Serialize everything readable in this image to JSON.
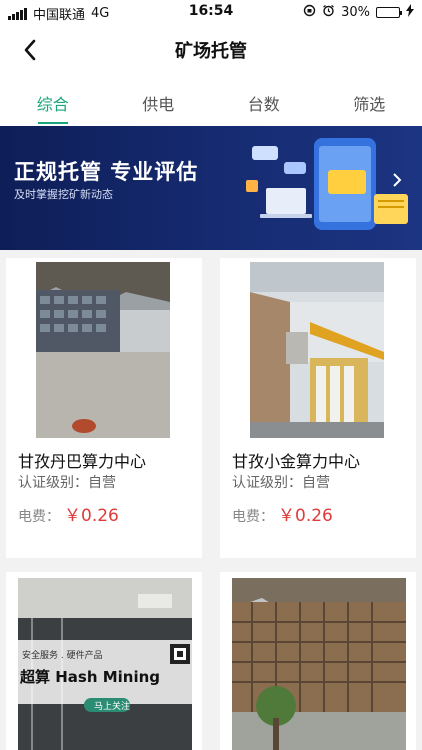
{
  "status_bar": {
    "carrier": "中国联通",
    "network": "4G",
    "time": "16:54",
    "battery": "30%",
    "battery_level": 0.3
  },
  "nav": {
    "title": "矿场托管"
  },
  "tabs": [
    {
      "label": "综合"
    },
    {
      "label": "供电"
    },
    {
      "label": "台数"
    },
    {
      "label": "筛选"
    }
  ],
  "banner": {
    "title": "正规托管  专业评估",
    "subtitle": "及时掌握挖矿新动态"
  },
  "cards": [
    {
      "name": "甘孜丹巴算力中心",
      "level": "认证级别：自营",
      "fee_label": "电费：",
      "price": "￥0.26"
    },
    {
      "name": "甘孜小金算力中心",
      "level": "认证级别：自营",
      "fee_label": "电费：",
      "price": "￥0.26"
    },
    {
      "name": "",
      "level": "",
      "fee_label": "",
      "price": "",
      "ad": {
        "top": "安全服务 . 硬件产品",
        "brand": "超算  Hash Mining",
        "button": "马上关注"
      }
    },
    {
      "name": "",
      "level": "",
      "fee_label": "",
      "price": ""
    }
  ],
  "colors": {
    "accent": "#1aa57a",
    "price": "#e03a3a",
    "banner_bg": "#0e1e57"
  }
}
